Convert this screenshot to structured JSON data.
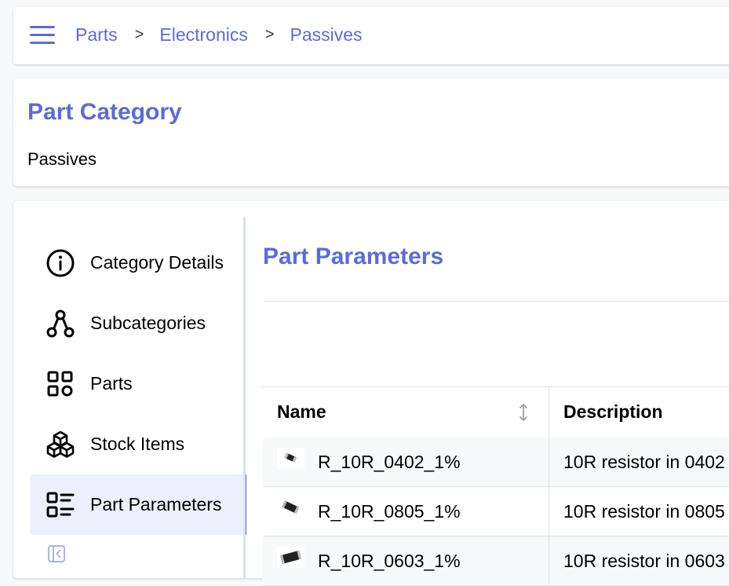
{
  "header": {
    "menu_icon": "hamburger-menu-icon",
    "breadcrumbs": [
      "Parts",
      "Electronics",
      "Passives"
    ],
    "separator": ">"
  },
  "category": {
    "title": "Part Category",
    "name": "Passives"
  },
  "sidebar": {
    "items": [
      {
        "label": "Category Details",
        "icon": "info-circle-icon",
        "active": false
      },
      {
        "label": "Subcategories",
        "icon": "hierarchy-icon",
        "active": false
      },
      {
        "label": "Parts",
        "icon": "grid-icon",
        "active": false
      },
      {
        "label": "Stock Items",
        "icon": "boxes-icon",
        "active": false
      },
      {
        "label": "Part Parameters",
        "icon": "list-details-icon",
        "active": true
      }
    ],
    "collapse_icon": "sidebar-collapse-icon"
  },
  "panel": {
    "title": "Part Parameters"
  },
  "table": {
    "columns": [
      "Name",
      "Description"
    ],
    "rows": [
      {
        "name": "R_10R_0402_1%",
        "description": "10R resistor in 0402"
      },
      {
        "name": "R_10R_0805_1%",
        "description": "10R resistor in 0805"
      },
      {
        "name": "R_10R_0603_1%",
        "description": "10R resistor in 0603"
      }
    ]
  },
  "colors": {
    "accent": "#5c6bd8",
    "active_bg": "#edf0fc",
    "border": "#dee2e6"
  }
}
